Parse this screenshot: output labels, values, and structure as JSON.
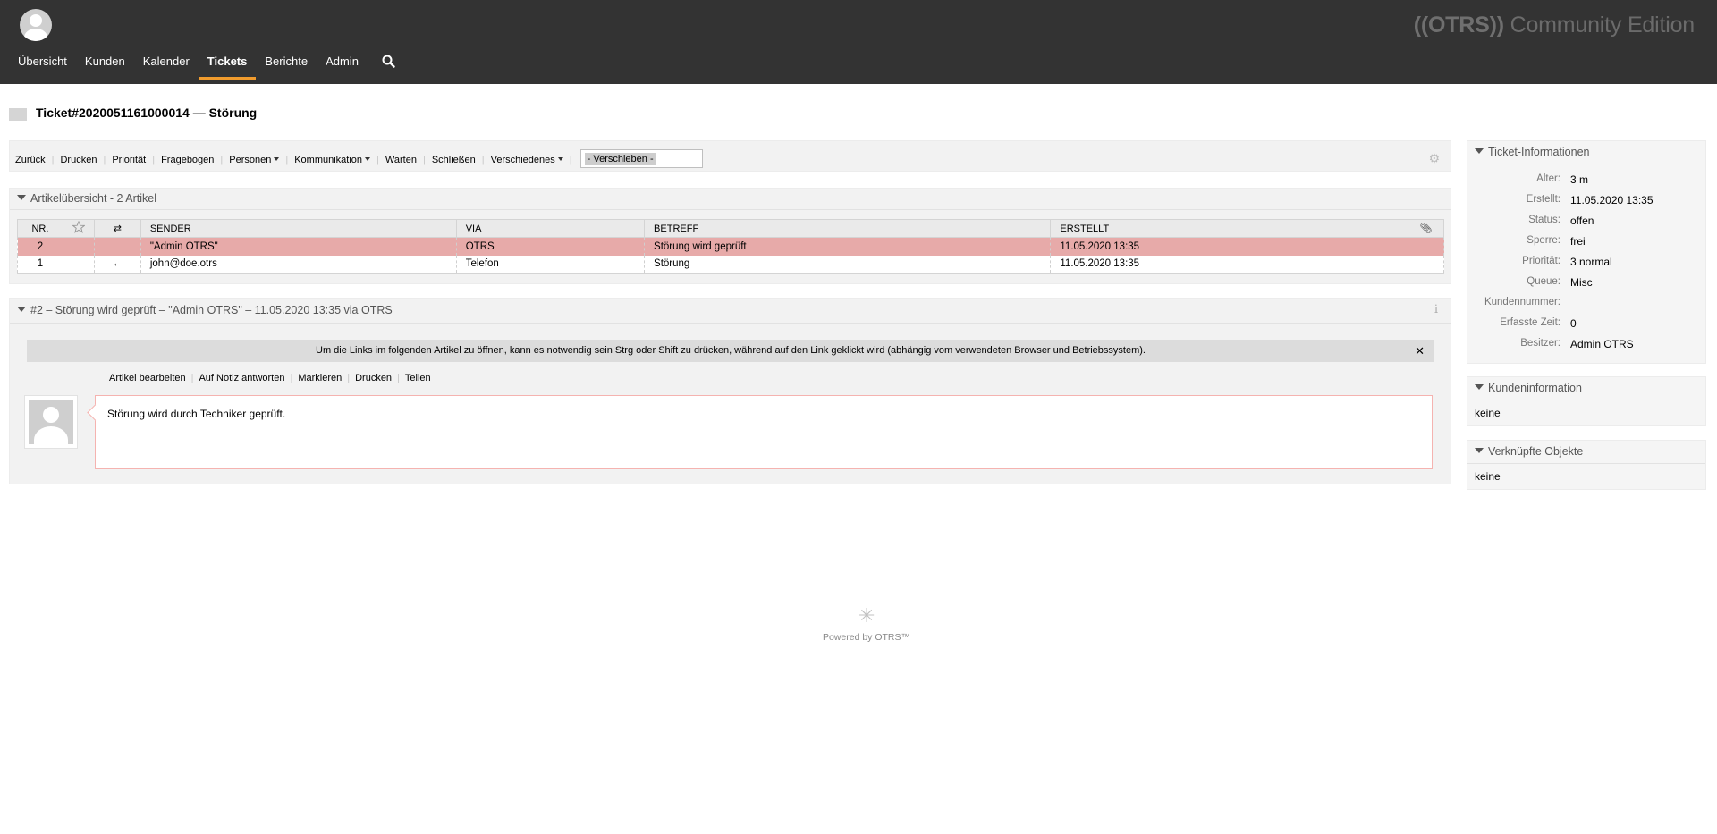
{
  "brand": {
    "prefix": "((OTRS))",
    "suffix": " Community Edition"
  },
  "nav": [
    {
      "label": "Übersicht"
    },
    {
      "label": "Kunden"
    },
    {
      "label": "Kalender"
    },
    {
      "label": "Tickets",
      "active": true
    },
    {
      "label": "Berichte"
    },
    {
      "label": "Admin"
    }
  ],
  "page": {
    "title": "Ticket#2020051161000014 — Störung"
  },
  "toolbar": {
    "back": "Zurück",
    "print": "Drucken",
    "priority": "Priorität",
    "questionnaire": "Fragebogen",
    "persons": "Personen",
    "communication": "Kommunikation",
    "wait": "Warten",
    "close": "Schließen",
    "misc": "Verschiedenes",
    "move_select": "- Verschieben -"
  },
  "overview": {
    "title": "Artikelübersicht - 2 Artikel",
    "columns": {
      "nr": "NR.",
      "sender": "SENDER",
      "via": "VIA",
      "subject": "BETREFF",
      "created": "ERSTELLT"
    },
    "rows": [
      {
        "nr": "2",
        "direction": "",
        "sender": "\"Admin OTRS\"",
        "via": "OTRS",
        "subject": "Störung wird geprüft",
        "created": "11.05.2020 13:35",
        "selected": true
      },
      {
        "nr": "1",
        "direction": "←",
        "sender": "john@doe.otrs",
        "via": "Telefon",
        "subject": "Störung",
        "created": "11.05.2020 13:35",
        "selected": false
      }
    ]
  },
  "article": {
    "heading": "#2 – Störung wird geprüft – \"Admin OTRS\" – 11.05.2020 13:35 via OTRS",
    "notice": "Um die Links im folgenden Artikel zu öffnen, kann es notwendig sein Strg oder Shift zu drücken, während auf den Link geklickt wird (abhängig vom verwendeten Browser und Betriebssystem).",
    "actions": {
      "edit": "Artikel bearbeiten",
      "reply_note": "Auf Notiz antworten",
      "mark": "Markieren",
      "print": "Drucken",
      "share": "Teilen"
    },
    "body": "Störung wird durch Techniker geprüft."
  },
  "ticket_info": {
    "title": "Ticket-Informationen",
    "rows": [
      {
        "label": "Alter:",
        "value": "3 m"
      },
      {
        "label": "Erstellt:",
        "value": "11.05.2020 13:35"
      },
      {
        "label": "Status:",
        "value": "offen"
      },
      {
        "label": "Sperre:",
        "value": "frei"
      },
      {
        "label": "Priorität:",
        "value": "3 normal"
      },
      {
        "label": "Queue:",
        "value": "Misc"
      },
      {
        "label": "Kundennummer:",
        "value": ""
      },
      {
        "label": "Erfasste Zeit:",
        "value": "0"
      },
      {
        "label": "Besitzer:",
        "value": "Admin OTRS"
      }
    ]
  },
  "customer_info": {
    "title": "Kundeninformation",
    "value": "keine"
  },
  "linked_objects": {
    "title": "Verknüpfte Objekte",
    "value": "keine"
  },
  "footer": {
    "text": "Powered by OTRS™"
  },
  "colors": {
    "accent": "#f09b2d",
    "header_bg": "#333333",
    "selected_row": "#e7aaa9"
  }
}
